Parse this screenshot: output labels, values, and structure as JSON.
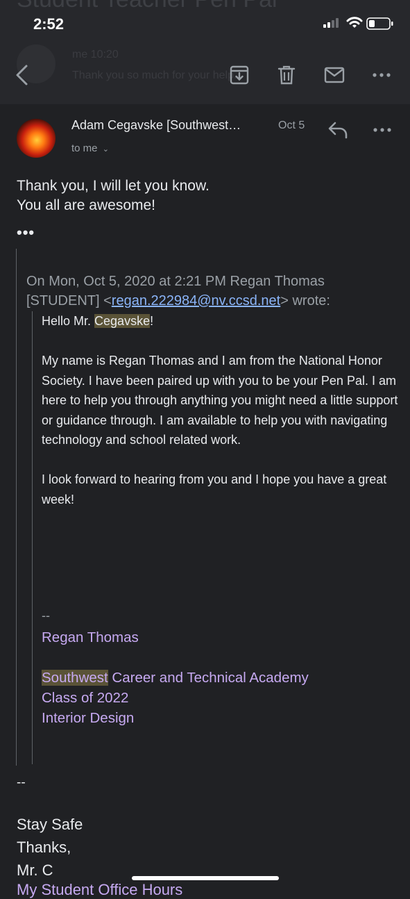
{
  "status": {
    "time": "2:52"
  },
  "background_header": {
    "title": "Student Teacher Pen Pal",
    "preview_line1": "me  10:20",
    "preview_line2": "Thank you so much for your help."
  },
  "toolbar": {
    "back_icon": "back-arrow-icon",
    "archive_icon": "archive-icon",
    "delete_icon": "trash-icon",
    "mail_icon": "mail-icon",
    "more_icon": "more-dots-icon"
  },
  "message": {
    "sender": "Adam Cegavske [Southwest…",
    "date": "Oct 5",
    "recipient": "to me",
    "body_line1": "Thank you, I will let you know.",
    "body_line2": "You all are awesome!",
    "trimmed": "•••",
    "quote_header_pre": "On Mon, Oct 5, 2020 at 2:21 PM Regan Thomas [STUDENT] <",
    "quote_email": "regan.222984@nv.ccsd.net",
    "quote_header_post": "> wrote:",
    "greeting_pre": "Hello Mr. ",
    "greeting_name": "Cegavske",
    "greeting_post": "!",
    "para1": "My name is Regan Thomas and I am from the National Honor Society. I have been paired up with you to be your Pen Pal. I am here to help you through anything you might need a little support or guidance through. I am available to help you with navigating technology and school related work.",
    "para2": "I look forward to hearing from you and I hope you have a great week!",
    "sig_dash": "--",
    "sig_name": "Regan Thomas",
    "sig_school_hl": "Southwest",
    "sig_school_rest": " Career and Technical Academy",
    "sig_class": "Class of 2022",
    "sig_program": "Interior Design",
    "footer_dash": "--",
    "footer_line1": "Stay Safe",
    "footer_line2": "Thanks,",
    "footer_line3": "Mr. C",
    "footer_line4": "My Student Office Hours"
  },
  "colors": {
    "background": "#202124",
    "link": "#8ab4f8",
    "signature": "#c6a9f1",
    "highlight": "#5a5337"
  }
}
